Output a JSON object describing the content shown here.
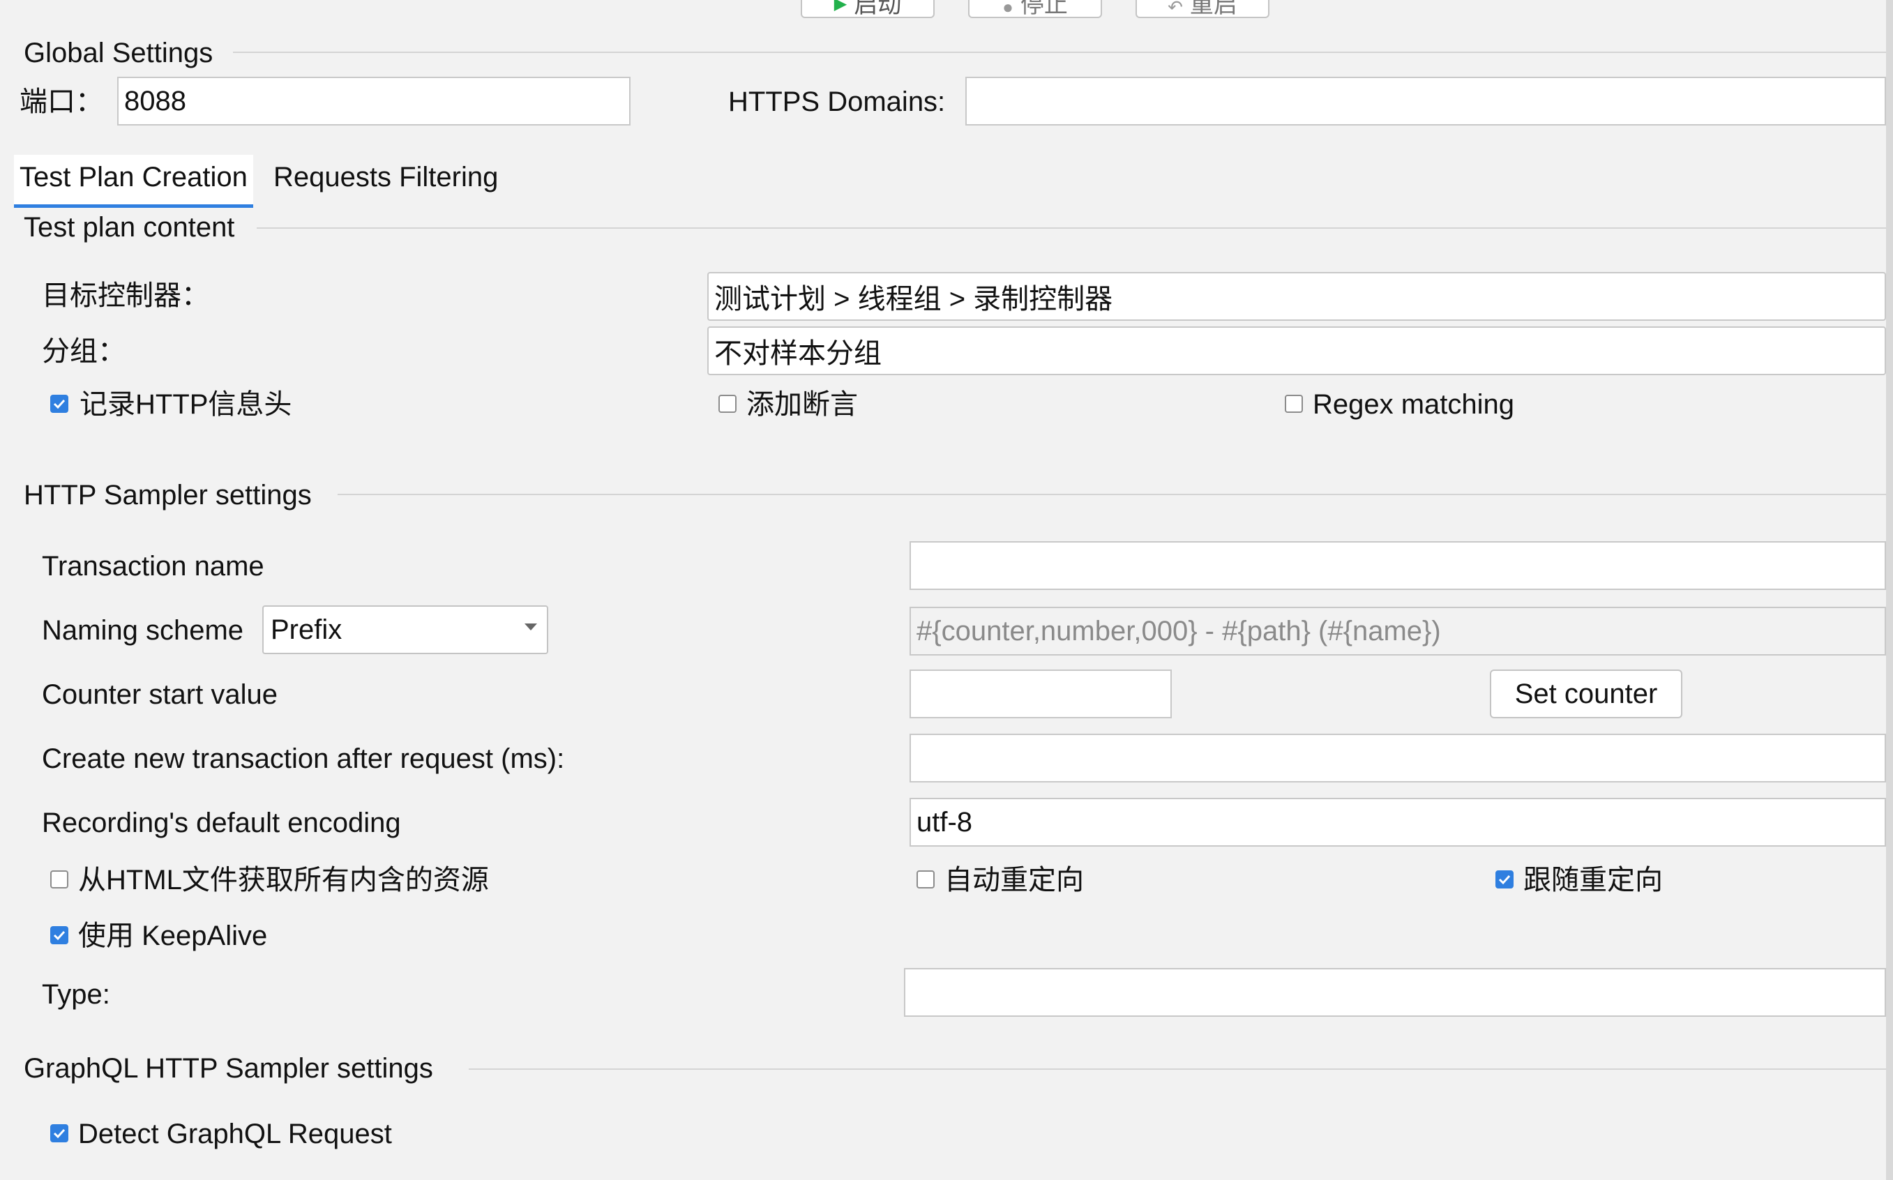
{
  "toolbar": {
    "start_label": "启动",
    "stop_label": "停止",
    "restart_label": "重启"
  },
  "global_settings": {
    "title": "Global Settings",
    "port_label": "端口：",
    "port_value": "8088",
    "https_label": "HTTPS Domains:",
    "https_value": ""
  },
  "tabs": [
    {
      "label": "Test Plan Creation",
      "active": true
    },
    {
      "label": "Requests Filtering",
      "active": false
    }
  ],
  "test_plan": {
    "title": "Test plan content",
    "target_label": "目标控制器：",
    "target_value": "测试计划 > 线程组 > 录制控制器",
    "grouping_label": "分组：",
    "grouping_value": "不对样本分组",
    "record_headers_label": "记录HTTP信息头",
    "record_headers_checked": true,
    "add_assertions_label": "添加断言",
    "add_assertions_checked": false,
    "regex_label": "Regex matching",
    "regex_checked": false
  },
  "http_sampler": {
    "title": "HTTP Sampler settings",
    "transaction_label": "Transaction name",
    "transaction_value": "",
    "naming_label": "Naming scheme",
    "naming_value": "Prefix",
    "naming_format": "#{counter,number,000} - #{path} (#{name})",
    "counter_label": "Counter start value",
    "counter_value": "",
    "set_counter_label": "Set counter",
    "new_tx_label": "Create new transaction after request (ms):",
    "new_tx_value": "",
    "encoding_label": "Recording's default encoding",
    "encoding_value": "utf-8",
    "fetch_resources_label": "从HTML文件获取所有内含的资源",
    "fetch_resources_checked": false,
    "auto_redirect_label": "自动重定向",
    "auto_redirect_checked": false,
    "follow_redirect_label": "跟随重定向",
    "follow_redirect_checked": true,
    "keepalive_label": "使用 KeepAlive",
    "keepalive_checked": true,
    "type_label": "Type:",
    "type_value": ""
  },
  "graphql": {
    "title": "GraphQL HTTP Sampler settings",
    "detect_label": "Detect GraphQL Request",
    "detect_checked": true
  },
  "colors": {
    "accent": "#2f7fe0",
    "background": "#f2f2f2"
  }
}
